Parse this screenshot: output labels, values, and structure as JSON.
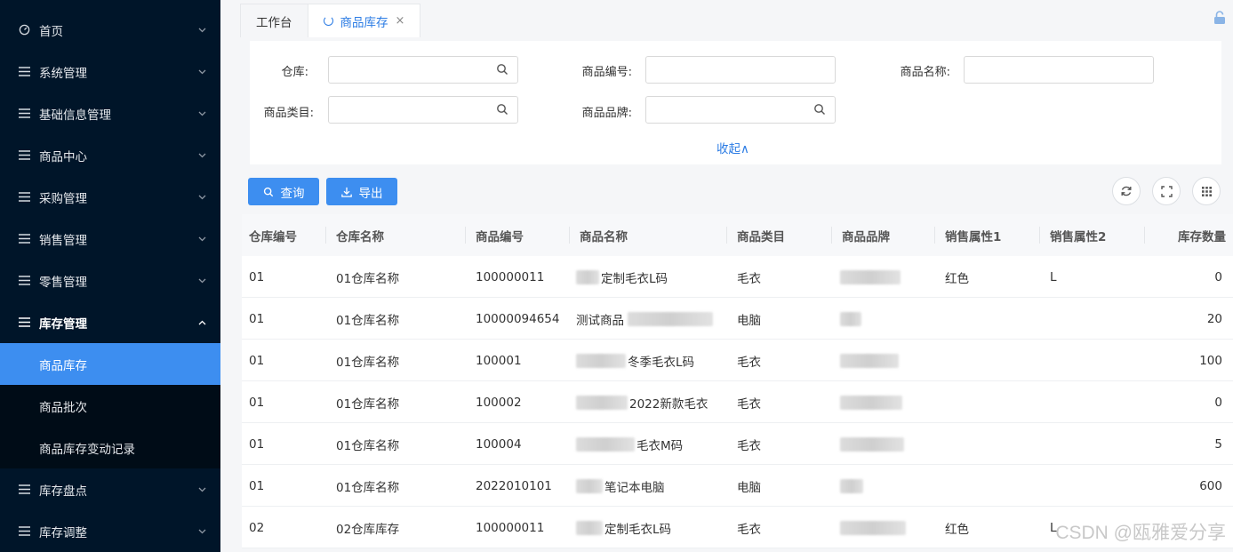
{
  "sidebar": {
    "items": [
      {
        "label": "首页",
        "icon": "dashboard-icon"
      },
      {
        "label": "系统管理",
        "icon": "menu-icon"
      },
      {
        "label": "基础信息管理",
        "icon": "menu-icon"
      },
      {
        "label": "商品中心",
        "icon": "menu-icon"
      },
      {
        "label": "采购管理",
        "icon": "menu-icon"
      },
      {
        "label": "销售管理",
        "icon": "menu-icon"
      },
      {
        "label": "零售管理",
        "icon": "menu-icon"
      },
      {
        "label": "库存管理",
        "icon": "menu-icon",
        "open": true
      },
      {
        "label": "库存盘点",
        "icon": "menu-icon"
      },
      {
        "label": "库存调整",
        "icon": "menu-icon"
      }
    ],
    "sub_items": [
      {
        "label": "商品库存",
        "active": true
      },
      {
        "label": "商品批次"
      },
      {
        "label": "商品库存变动记录"
      }
    ]
  },
  "tabs": [
    {
      "label": "工作台"
    },
    {
      "label": "商品库存",
      "active": true,
      "close": "×"
    }
  ],
  "filters": {
    "warehouse_label": "仓库:",
    "product_code_label": "商品编号:",
    "product_name_label": "商品名称:",
    "category_label": "商品类目:",
    "brand_label": "商品品牌:",
    "collapse_label": "收起∧"
  },
  "toolbar": {
    "query_label": "查询",
    "export_label": "导出"
  },
  "table": {
    "headers": [
      "仓库编号",
      "仓库名称",
      "商品编号",
      "商品名称",
      "商品类目",
      "商品品牌",
      "销售属性1",
      "销售属性2",
      "库存数量"
    ],
    "rows": [
      {
        "wh_code": "01",
        "wh_name": "01仓库名称",
        "code": "100000011",
        "name": "定制毛衣L码",
        "category": "毛衣",
        "attr1": "红色",
        "attr2": "L",
        "qty": "0"
      },
      {
        "wh_code": "01",
        "wh_name": "01仓库名称",
        "code": "10000094654",
        "name": "测试商品",
        "category": "电脑",
        "attr1": "",
        "attr2": "",
        "qty": "20"
      },
      {
        "wh_code": "01",
        "wh_name": "01仓库名称",
        "code": "100001",
        "name": "冬季毛衣L码",
        "category": "毛衣",
        "attr1": "",
        "attr2": "",
        "qty": "100"
      },
      {
        "wh_code": "01",
        "wh_name": "01仓库名称",
        "code": "100002",
        "name": "2022新款毛衣",
        "category": "毛衣",
        "attr1": "",
        "attr2": "",
        "qty": "0"
      },
      {
        "wh_code": "01",
        "wh_name": "01仓库名称",
        "code": "100004",
        "name": "毛衣M码",
        "category": "毛衣",
        "attr1": "",
        "attr2": "",
        "qty": "5"
      },
      {
        "wh_code": "01",
        "wh_name": "01仓库名称",
        "code": "2022010101",
        "name": "笔记本电脑",
        "category": "电脑",
        "attr1": "",
        "attr2": "",
        "qty": "600"
      },
      {
        "wh_code": "02",
        "wh_name": "02仓库库存",
        "code": "100000011",
        "name": "定制毛衣L码",
        "category": "毛衣",
        "attr1": "红色",
        "attr2": "L",
        "qty": ""
      }
    ]
  },
  "watermark": "CSDN @瓯雅爱分享",
  "colors": {
    "primary": "#3d8ef0",
    "sidebar_bg": "#001529",
    "link": "#2a7be4"
  }
}
